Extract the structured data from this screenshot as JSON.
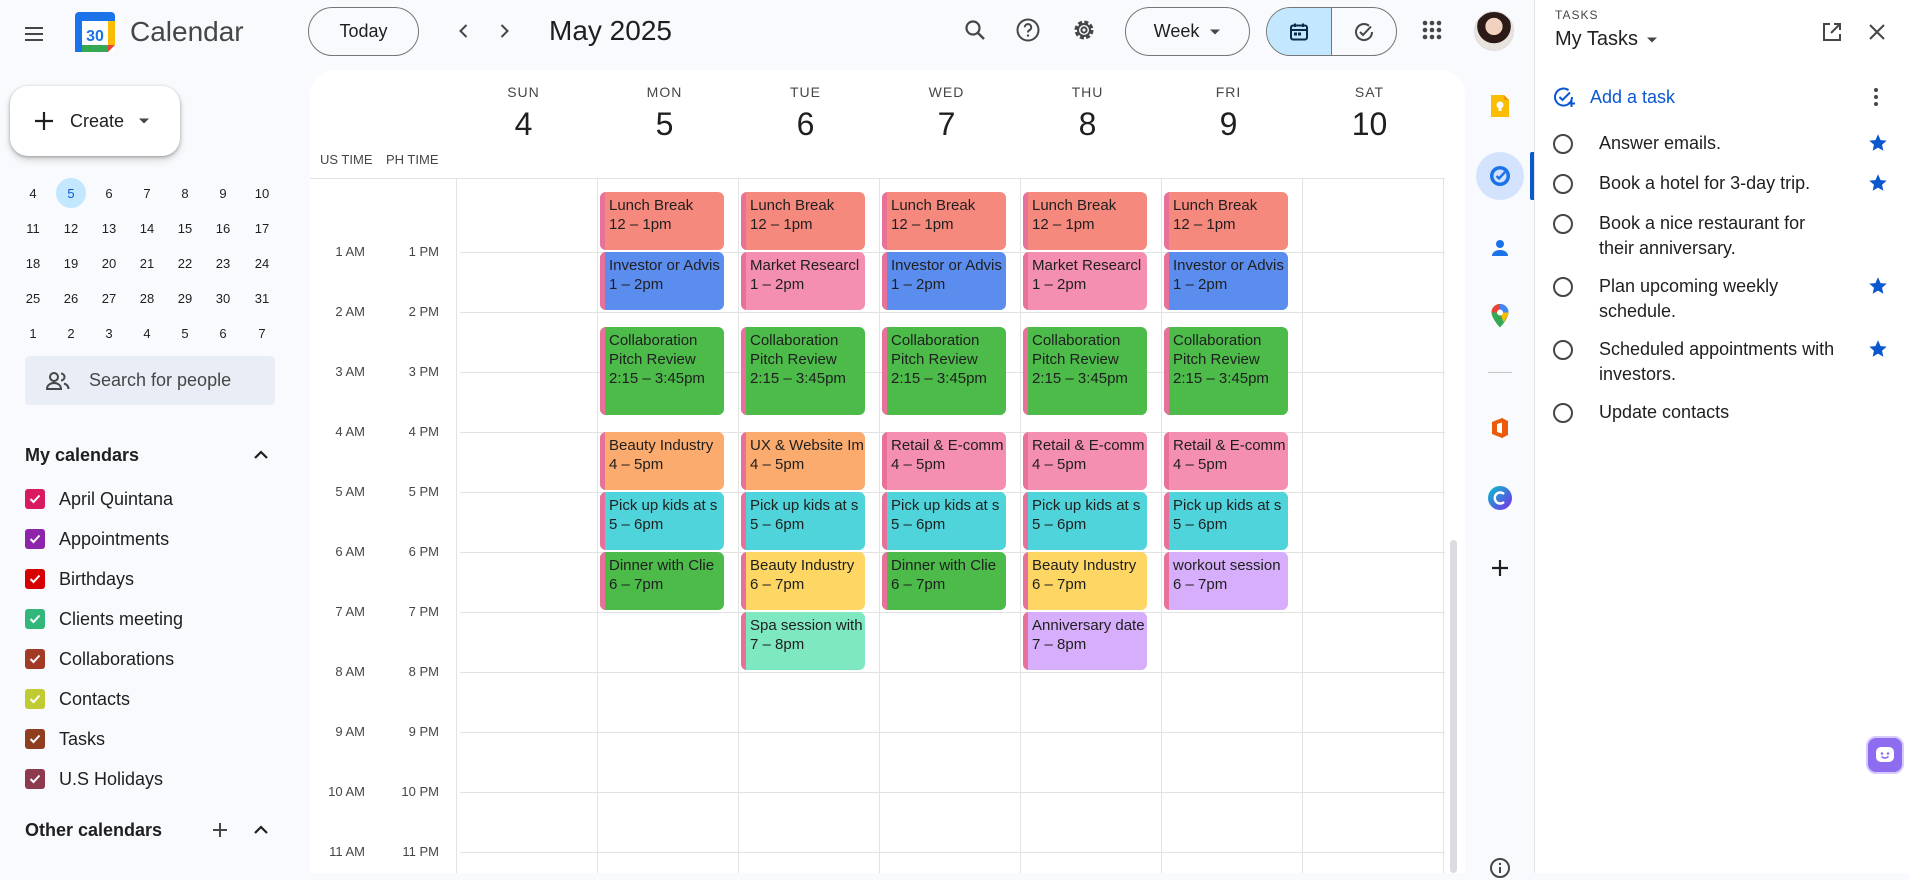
{
  "header": {
    "app_title": "Calendar",
    "logo_day": "30",
    "today_label": "Today",
    "date_label": "May 2025",
    "view_label": "Week"
  },
  "sidebar": {
    "create_label": "Create",
    "mini_calendar": {
      "selected": "5",
      "weeks": [
        [
          "4",
          "5",
          "6",
          "7",
          "8",
          "9",
          "10"
        ],
        [
          "11",
          "12",
          "13",
          "14",
          "15",
          "16",
          "17"
        ],
        [
          "18",
          "19",
          "20",
          "21",
          "22",
          "23",
          "24"
        ],
        [
          "25",
          "26",
          "27",
          "28",
          "29",
          "30",
          "31"
        ],
        [
          "1",
          "2",
          "3",
          "4",
          "5",
          "6",
          "7"
        ]
      ]
    },
    "search_people_placeholder": "Search for people",
    "my_calendars_label": "My calendars",
    "my_calendars": [
      {
        "name": "April Quintana",
        "color": "#d81b60"
      },
      {
        "name": "Appointments",
        "color": "#8e24aa"
      },
      {
        "name": "Birthdays",
        "color": "#d50000"
      },
      {
        "name": "Clients meeting",
        "color": "#33b679"
      },
      {
        "name": "Collaborations",
        "color": "#a33a26"
      },
      {
        "name": "Contacts",
        "color": "#c0ca33"
      },
      {
        "name": "Tasks",
        "color": "#8f3e1f"
      },
      {
        "name": "U.S Holidays",
        "color": "#8d3a4e"
      }
    ],
    "other_calendars_label": "Other calendars"
  },
  "week": {
    "days": [
      {
        "name": "SUN",
        "num": "4"
      },
      {
        "name": "MON",
        "num": "5"
      },
      {
        "name": "TUE",
        "num": "6"
      },
      {
        "name": "WED",
        "num": "7"
      },
      {
        "name": "THU",
        "num": "8"
      },
      {
        "name": "FRI",
        "num": "9"
      },
      {
        "name": "SAT",
        "num": "10"
      }
    ],
    "timezones": [
      "US TIME",
      "PH TIME"
    ],
    "hours": [
      {
        "us": "1 AM",
        "ph": "1 PM"
      },
      {
        "us": "2 AM",
        "ph": "2 PM"
      },
      {
        "us": "3 AM",
        "ph": "3 PM"
      },
      {
        "us": "4 AM",
        "ph": "4 PM"
      },
      {
        "us": "5 AM",
        "ph": "5 PM"
      },
      {
        "us": "6 AM",
        "ph": "6 PM"
      },
      {
        "us": "7 AM",
        "ph": "7 PM"
      },
      {
        "us": "8 AM",
        "ph": "8 PM"
      },
      {
        "us": "9 AM",
        "ph": "9 PM"
      },
      {
        "us": "10 AM",
        "ph": "10 PM"
      },
      {
        "us": "11 AM",
        "ph": "11 PM"
      }
    ],
    "events": [
      {
        "day": 1,
        "start": 12,
        "end": 13,
        "title": "Lunch Break",
        "time": "12 – 1pm",
        "color": "#f6897d"
      },
      {
        "day": 2,
        "start": 12,
        "end": 13,
        "title": "Lunch Break",
        "time": "12 – 1pm",
        "color": "#f6897d"
      },
      {
        "day": 3,
        "start": 12,
        "end": 13,
        "title": "Lunch Break",
        "time": "12 – 1pm",
        "color": "#f6897d"
      },
      {
        "day": 4,
        "start": 12,
        "end": 13,
        "title": "Lunch Break",
        "time": "12 – 1pm",
        "color": "#f6897d"
      },
      {
        "day": 5,
        "start": 12,
        "end": 13,
        "title": "Lunch Break",
        "time": "12 – 1pm",
        "color": "#f6897d"
      },
      {
        "day": 1,
        "start": 13,
        "end": 14,
        "title": "Investor or Advis",
        "time": "1 – 2pm",
        "color": "#5b8def"
      },
      {
        "day": 2,
        "start": 13,
        "end": 14,
        "title": "Market Researcl",
        "time": "1 – 2pm",
        "color": "#f58fb2"
      },
      {
        "day": 3,
        "start": 13,
        "end": 14,
        "title": "Investor or Advis",
        "time": "1 – 2pm",
        "color": "#5b8def"
      },
      {
        "day": 4,
        "start": 13,
        "end": 14,
        "title": "Market Researcl",
        "time": "1 – 2pm",
        "color": "#f58fb2"
      },
      {
        "day": 5,
        "start": 13,
        "end": 14,
        "title": "Investor or Advis",
        "time": "1 – 2pm",
        "color": "#5b8def"
      },
      {
        "day": 1,
        "start": 14.25,
        "end": 15.75,
        "title": "Collaboration Pitch Review",
        "time": "2:15 – 3:45pm",
        "color": "#4cbb4a"
      },
      {
        "day": 2,
        "start": 14.25,
        "end": 15.75,
        "title": "Collaboration Pitch Review",
        "time": "2:15 – 3:45pm",
        "color": "#4cbb4a"
      },
      {
        "day": 3,
        "start": 14.25,
        "end": 15.75,
        "title": "Collaboration Pitch Review",
        "time": "2:15 – 3:45pm",
        "color": "#4cbb4a"
      },
      {
        "day": 4,
        "start": 14.25,
        "end": 15.75,
        "title": "Collaboration Pitch Review",
        "time": "2:15 – 3:45pm",
        "color": "#4cbb4a"
      },
      {
        "day": 5,
        "start": 14.25,
        "end": 15.75,
        "title": "Collaboration Pitch Review",
        "time": "2:15 – 3:45pm",
        "color": "#4cbb4a"
      },
      {
        "day": 1,
        "start": 16,
        "end": 17,
        "title": "Beauty Industry",
        "time": "4 – 5pm",
        "color": "#fbab6e"
      },
      {
        "day": 2,
        "start": 16,
        "end": 17,
        "title": "UX & Website Im",
        "time": "4 – 5pm",
        "color": "#fbab6e"
      },
      {
        "day": 3,
        "start": 16,
        "end": 17,
        "title": "Retail & E-comm",
        "time": "4 – 5pm",
        "color": "#f58fb2"
      },
      {
        "day": 4,
        "start": 16,
        "end": 17,
        "title": "Retail & E-comm",
        "time": "4 – 5pm",
        "color": "#f58fb2"
      },
      {
        "day": 5,
        "start": 16,
        "end": 17,
        "title": "Retail & E-comm",
        "time": "4 – 5pm",
        "color": "#f58fb2"
      },
      {
        "day": 1,
        "start": 17,
        "end": 18,
        "title": "Pick up kids at s",
        "time": "5 – 6pm",
        "color": "#4fd4dc"
      },
      {
        "day": 2,
        "start": 17,
        "end": 18,
        "title": "Pick up kids at s",
        "time": "5 – 6pm",
        "color": "#4fd4dc"
      },
      {
        "day": 3,
        "start": 17,
        "end": 18,
        "title": "Pick up kids at s",
        "time": "5 – 6pm",
        "color": "#4fd4dc"
      },
      {
        "day": 4,
        "start": 17,
        "end": 18,
        "title": "Pick up kids at s",
        "time": "5 – 6pm",
        "color": "#4fd4dc"
      },
      {
        "day": 5,
        "start": 17,
        "end": 18,
        "title": "Pick up kids at s",
        "time": "5 – 6pm",
        "color": "#4fd4dc"
      },
      {
        "day": 1,
        "start": 18,
        "end": 19,
        "title": "Dinner with Clie",
        "time": "6 – 7pm",
        "color": "#4cbb4a"
      },
      {
        "day": 2,
        "start": 18,
        "end": 19,
        "title": "Beauty Industry",
        "time": "6 – 7pm",
        "color": "#fdd663"
      },
      {
        "day": 3,
        "start": 18,
        "end": 19,
        "title": "Dinner with Clie",
        "time": "6 – 7pm",
        "color": "#4cbb4a"
      },
      {
        "day": 4,
        "start": 18,
        "end": 19,
        "title": "Beauty Industry",
        "time": "6 – 7pm",
        "color": "#fdd663"
      },
      {
        "day": 5,
        "start": 18,
        "end": 19,
        "title": "workout session",
        "time": "6 – 7pm",
        "color": "#d7aefb"
      },
      {
        "day": 2,
        "start": 19,
        "end": 20,
        "title": "Spa session with",
        "time": "7 – 8pm",
        "color": "#7ee8c0"
      },
      {
        "day": 4,
        "start": 19,
        "end": 20,
        "title": "Anniversary date",
        "time": "7 – 8pm",
        "color": "#d7aefb"
      }
    ]
  },
  "tasks": {
    "caption": "TASKS",
    "list_name": "My Tasks",
    "add_label": "Add a task",
    "items": [
      {
        "text": "Answer emails.",
        "starred": true
      },
      {
        "text": "Book a hotel for 3-day trip.",
        "starred": true
      },
      {
        "text": "Book a nice restaurant for their anniversary.",
        "starred": false
      },
      {
        "text": "Plan upcoming weekly schedule.",
        "starred": true
      },
      {
        "text": "Scheduled appointments with investors.",
        "starred": true
      },
      {
        "text": "Update contacts",
        "starred": false
      }
    ]
  },
  "colors": {
    "accent": "#0b57d0",
    "selected_bg": "#c2e7ff",
    "event_stripe": "#e8719a"
  }
}
